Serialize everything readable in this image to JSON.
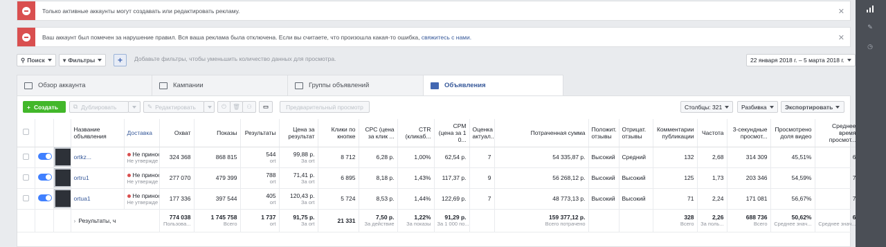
{
  "alerts": [
    {
      "text": "Только активные аккаунты могут создавать или редактировать рекламу.",
      "link": ""
    },
    {
      "text": "Ваш аккаунт был помечен за нарушение правил. Вся ваша реклама была отключена. Если вы считаете, что произошла какая-то ошибка, ",
      "link": "свяжитесь с нами."
    }
  ],
  "filters": {
    "search_label": "Поиск",
    "filters_label": "Фильтры",
    "add_label": "+",
    "hint": "Добавьте фильтры, чтобы уменьшить количество данных для просмотра.",
    "date_range": "22 января 2018 г. – 5 марта 2018 г."
  },
  "tabs": [
    {
      "label": "Обзор аккаунта",
      "icon": "account-overview-icon"
    },
    {
      "label": "Кампании",
      "icon": "folder-icon"
    },
    {
      "label": "Группы объявлений",
      "icon": "grid-icon"
    },
    {
      "label": "Объявления",
      "icon": "ad-icon"
    }
  ],
  "toolbar": {
    "create": "Создать",
    "duplicate": "Дублировать",
    "edit": "Редактировать",
    "preview": "Предварительный просмотр",
    "columns": "Столбцы: 321",
    "breakdown": "Разбивка",
    "export": "Экспортировать"
  },
  "columns": [
    "Название объявления",
    "Доставка",
    "Охват",
    "Показы",
    "Результаты",
    "Цена за результат",
    "Клики по кнопке",
    "CPC (цена за клик ...",
    "CTR (кликаб...",
    "CPM (цена за 1 0...",
    "Оценка актуал...",
    "Потраченная сумма",
    "Положит. отзывы",
    "Отрицат. отзывы",
    "Комментарии публикации",
    "Частота",
    "3-секундные просмот...",
    "Просмотрено доля видео",
    "Среднее время просмот..."
  ],
  "rows": [
    {
      "name": "ortkz...",
      "delivery": "Не приноси",
      "delivery_sub": "Не утвержде",
      "reach": "324 368",
      "impressions": "868 815",
      "results": "544",
      "results_sub": "ort",
      "cpr": "99,88 р.",
      "cpr_sub": "За ort",
      "clicks": "8 712",
      "cpc": "6,28 р.",
      "ctr": "1,00%",
      "cpm": "62,54 р.",
      "relevance": "7",
      "spent": "54 335,87 р.",
      "pos": "Высокий",
      "neg": "Средний",
      "comments": "132",
      "freq": "2,68",
      "views3": "314 309",
      "vidpct": "45,51%",
      "avgtime": "6"
    },
    {
      "name": "ortru1",
      "delivery": "Не приноси",
      "delivery_sub": "Не утвержде",
      "reach": "277 070",
      "impressions": "479 399",
      "results": "788",
      "results_sub": "ort",
      "cpr": "71,41 р.",
      "cpr_sub": "За ort",
      "clicks": "6 895",
      "cpc": "8,18 р.",
      "ctr": "1,43%",
      "cpm": "117,37 р.",
      "relevance": "9",
      "spent": "56 268,12 р.",
      "pos": "Высокий",
      "neg": "Высокий",
      "comments": "125",
      "freq": "1,73",
      "views3": "203 346",
      "vidpct": "54,59%",
      "avgtime": "7"
    },
    {
      "name": "ortua1",
      "delivery": "Не приноси",
      "delivery_sub": "Не утвержде",
      "reach": "177 336",
      "impressions": "397 544",
      "results": "405",
      "results_sub": "ort",
      "cpr": "120,43 р.",
      "cpr_sub": "За ort",
      "clicks": "5 724",
      "cpc": "8,53 р.",
      "ctr": "1,44%",
      "cpm": "122,69 р.",
      "relevance": "7",
      "spent": "48 773,13 р.",
      "pos": "Высокий",
      "neg": "Высокий",
      "comments": "71",
      "freq": "2,24",
      "views3": "171 081",
      "vidpct": "56,67%",
      "avgtime": "7"
    }
  ],
  "totals": {
    "label": "Результаты, ч",
    "reach": "774 038",
    "reach_sub": "Пользова...",
    "impressions": "1 745 758",
    "impressions_sub": "Всего",
    "results": "1 737",
    "results_sub": "ort",
    "cpr": "91,75 р.",
    "cpr_sub": "За ort",
    "clicks": "21 331",
    "cpc": "7,50 р.",
    "cpc_sub": "За действие",
    "ctr": "1,22%",
    "ctr_sub": "За показы",
    "cpm": "91,29 р.",
    "cpm_sub": "За 1 000 по...",
    "spent": "159 377,12 р.",
    "spent_sub": "Всего потрачено",
    "comments": "328",
    "comments_sub": "Всего",
    "freq": "2,26",
    "freq_sub": "За поль...",
    "views3": "688 736",
    "views3_sub": "Всего",
    "vidpct": "50,62%",
    "vidpct_sub": "Среднее знач...",
    "avgtime": "6",
    "avgtime_sub": "Среднее знач..."
  }
}
